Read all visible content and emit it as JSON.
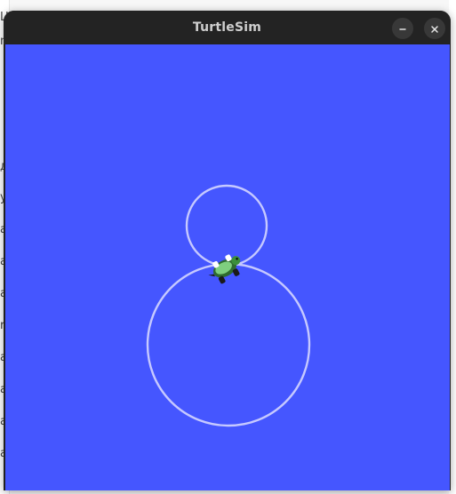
{
  "window": {
    "title": "TurtleSim"
  },
  "titlebar": {
    "minimize_icon": "minus-icon",
    "close_icon": "x-icon"
  },
  "canvas": {
    "background_color": "#4556ff",
    "trail_color": "#c6c9ff",
    "paths": [
      {
        "kind": "circle",
        "label": "small-loop"
      },
      {
        "kind": "circle",
        "label": "large-loop"
      }
    ],
    "turtle_icon": "turtle-icon"
  },
  "background_app": {
    "left_edge_chars": [
      "Ц",
      "n",
      "",
      "д",
      "у",
      "a",
      "a",
      "a",
      "r",
      "a",
      "a",
      "a",
      "a"
    ]
  }
}
